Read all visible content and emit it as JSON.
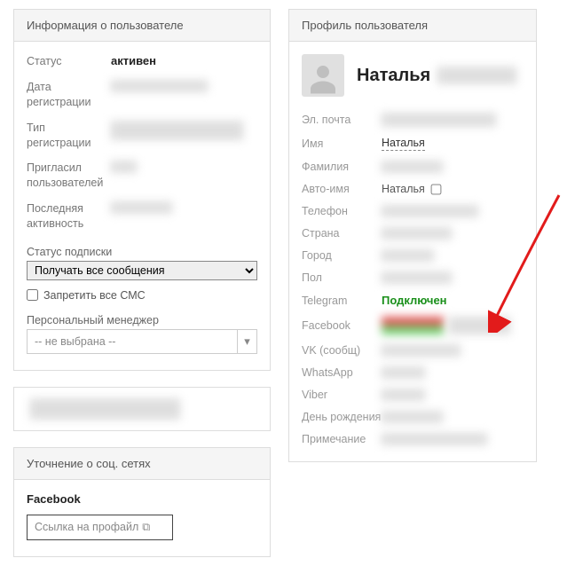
{
  "user_info": {
    "header": "Информация о пользователе",
    "status_label": "Статус",
    "status_value": "активен",
    "reg_date_label": "Дата регистрации",
    "reg_type_label": "Тип регистрации",
    "invited_label": "Пригласил пользователей",
    "last_activity_label": "Последняя активность",
    "sub_status_label": "Статус подписки",
    "sub_status_value": "Получать все сообщения",
    "forbid_sms_label": "Запретить все СМС",
    "pers_manager_label": "Персональный менеджер",
    "pers_manager_value": "-- не выбрана --"
  },
  "social": {
    "header": "Уточнение о соц. сетях",
    "facebook_label": "Facebook",
    "fb_placeholder": "Ссылка на профайл"
  },
  "profile": {
    "header": "Профиль пользователя",
    "name": "Наталья",
    "email_label": "Эл. почта",
    "first_name_label": "Имя",
    "first_name_value": "Наталья",
    "last_name_label": "Фамилия",
    "auto_name_label": "Авто-имя",
    "auto_name_value": "Наталья",
    "phone_label": "Телефон",
    "country_label": "Страна",
    "city_label": "Город",
    "gender_label": "Пол",
    "telegram_label": "Telegram",
    "telegram_value": "Подключен",
    "facebook_label": "Facebook",
    "vk_label": "VK (сообщ)",
    "whatsapp_label": "WhatsApp",
    "viber_label": "Viber",
    "birthday_label": "День рождения",
    "notes_label": "Примечание"
  }
}
